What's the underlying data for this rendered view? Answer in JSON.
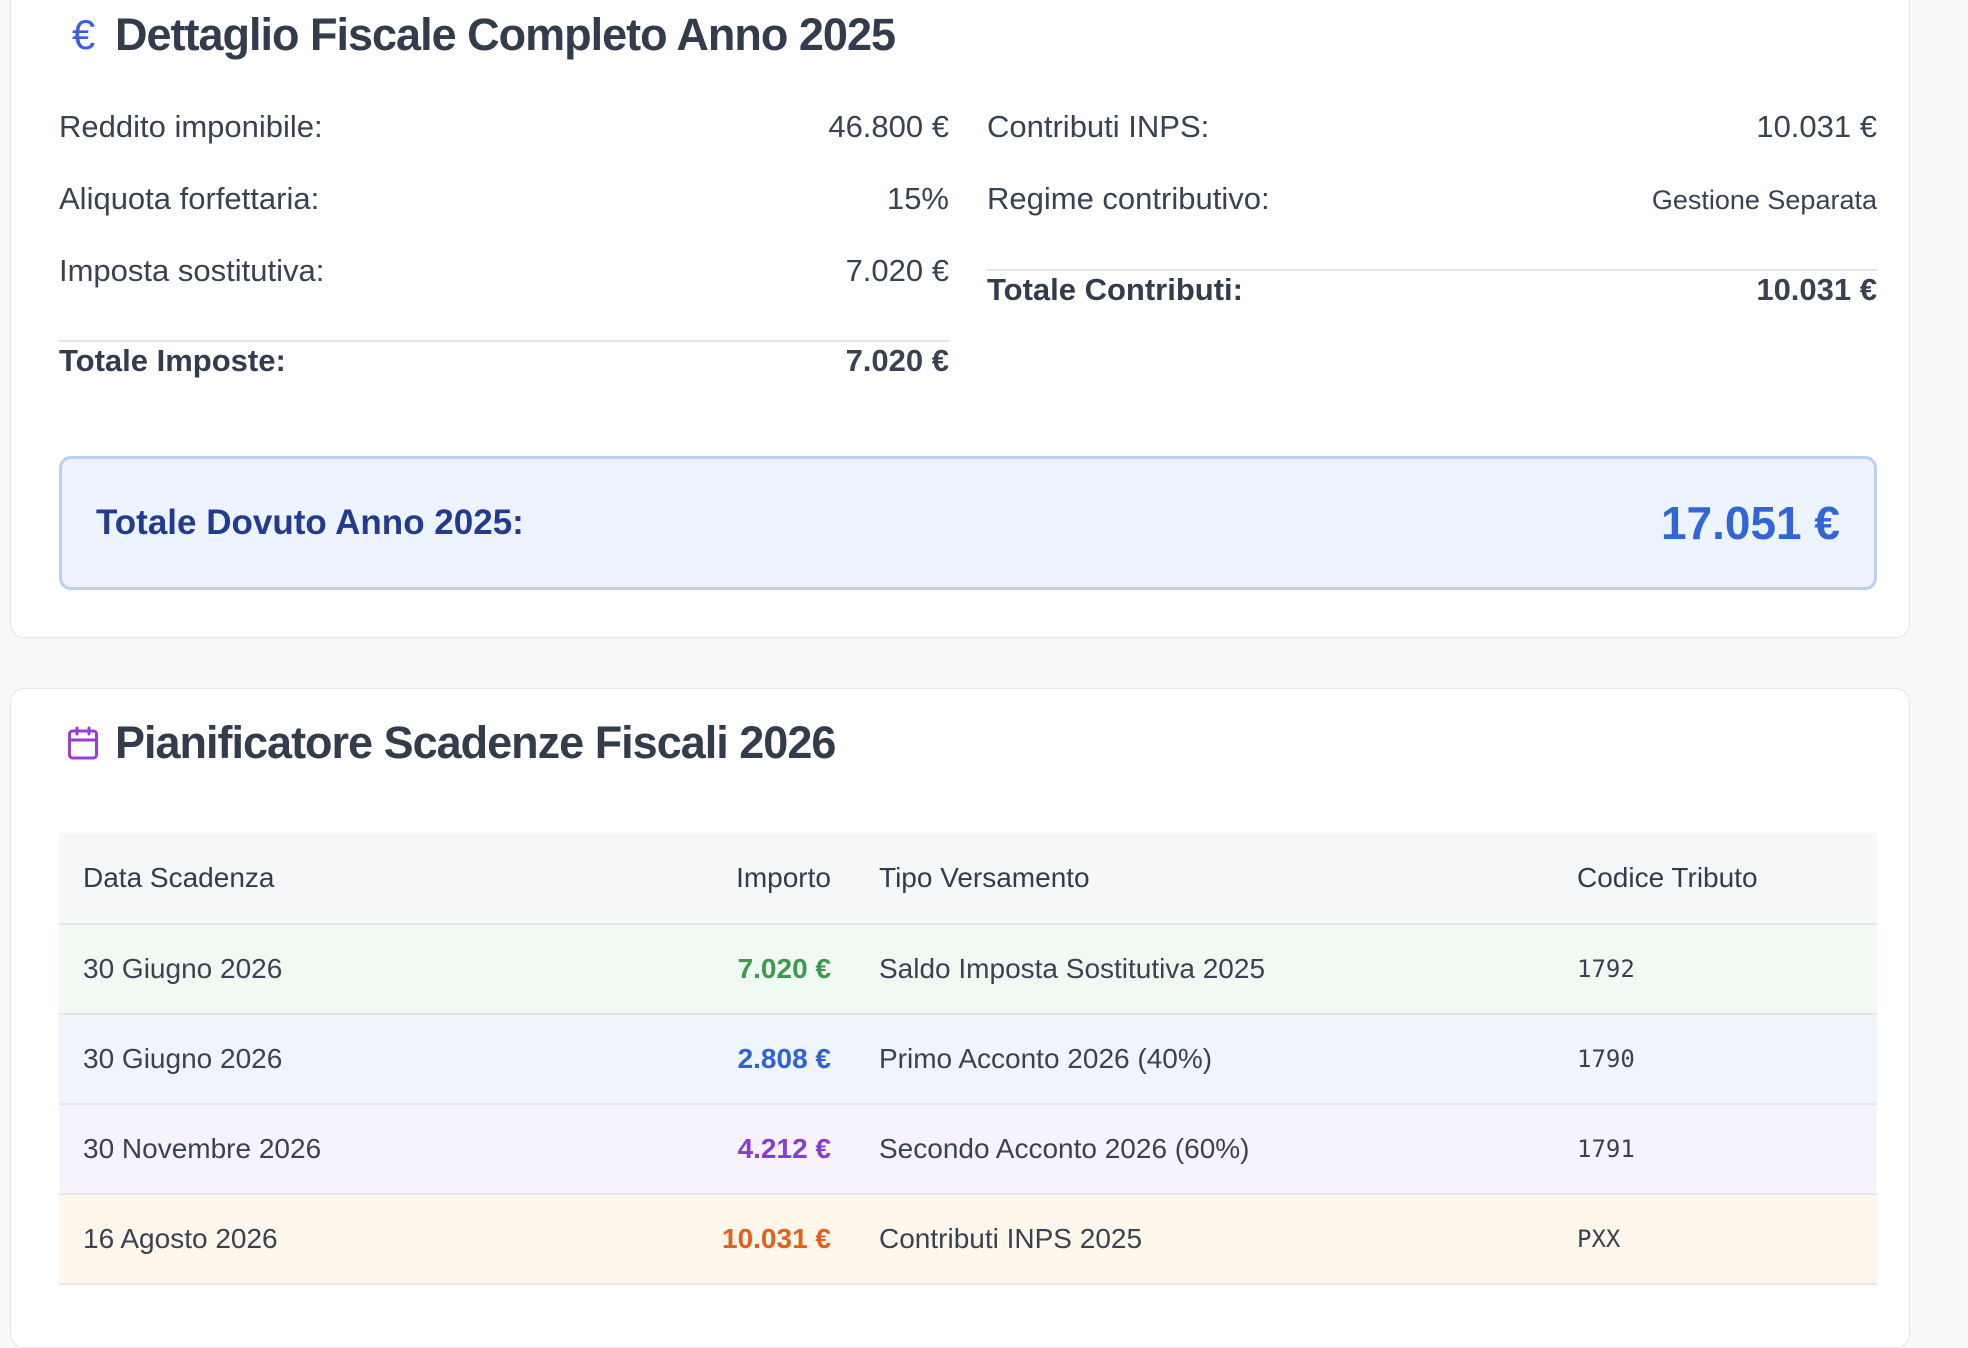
{
  "fiscal_detail": {
    "title": "Dettaglio Fiscale Completo Anno 2025",
    "icon": "euro-icon",
    "left": {
      "rows": [
        {
          "label": "Reddito imponibile:",
          "value": "46.800 €"
        },
        {
          "label": "Aliquota forfettaria:",
          "value": "15%"
        },
        {
          "label": "Imposta sostitutiva:",
          "value": "7.020 €"
        }
      ],
      "total": {
        "label": "Totale Imposte:",
        "value": "7.020 €"
      }
    },
    "right": {
      "rows": [
        {
          "label": "Contributi INPS:",
          "value": "10.031 €"
        },
        {
          "label": "Regime contributivo:",
          "value": "Gestione Separata"
        }
      ],
      "total": {
        "label": "Totale Contributi:",
        "value": "10.031 €"
      }
    },
    "grand_total": {
      "label": "Totale Dovuto Anno 2025:",
      "value": "17.051 €"
    }
  },
  "planner": {
    "title": "Pianificatore Scadenze Fiscali 2026",
    "icon": "calendar-icon",
    "columns": [
      "Data Scadenza",
      "Importo",
      "Tipo Versamento",
      "Codice Tributo"
    ],
    "rows": [
      {
        "date": "30 Giugno 2026",
        "amount": "7.020 €",
        "type": "Saldo Imposta Sostitutiva 2025",
        "code": "1792",
        "bg": "#f1f9f3",
        "amount_color": "#3c9a4e"
      },
      {
        "date": "30 Giugno 2026",
        "amount": "2.808 €",
        "type": "Primo Acconto 2026 (40%)",
        "code": "1790",
        "bg": "#eff4fd",
        "amount_color": "#2f62d6"
      },
      {
        "date": "30 Novembre 2026",
        "amount": "4.212 €",
        "type": "Secondo Acconto 2026 (60%)",
        "code": "1791",
        "bg": "#f6f3fd",
        "amount_color": "#8a3ad8"
      },
      {
        "date": "16 Agosto 2026",
        "amount": "10.031 €",
        "type": "Contributi INPS 2025",
        "code": "PXX",
        "bg": "#fff6ec",
        "amount_color": "#e0601c"
      }
    ]
  },
  "colors": {
    "accent_blue": "#3266d6",
    "calendar_purple": "#9b3bd8"
  }
}
